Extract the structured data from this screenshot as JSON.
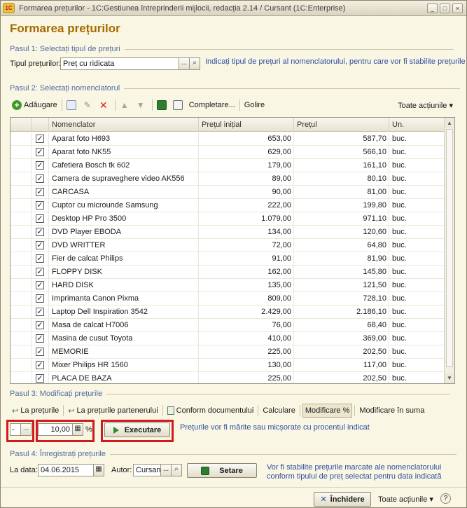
{
  "window": {
    "logo": "1C",
    "title": "Formarea prețurilor - 1C:Gestiunea întreprinderii mijlocii, redacția 2.14 / Cursant  (1C:Enterprise)",
    "minimize": "_",
    "maximize": "□",
    "close": "×"
  },
  "page_title": "Formarea prețurilor",
  "step1": {
    "header": "Pasul 1: Selectați tipul de prețuri",
    "price_type_label": "Tipul prețurilor:",
    "price_type_value": "Preț cu ridicata",
    "select_button": "...",
    "search_button": "⌕",
    "hint": "Indicați tipul de prețuri al nomenclatorului, pentru care vor fi stabilite prețurile"
  },
  "step2": {
    "header": "Pasul 2: Selectați nomenclatorul",
    "toolbar": {
      "add": "Adăugare",
      "fill": "Completare...",
      "clear": "Golire",
      "all_actions": "Toate acțiunile ▾"
    },
    "columns": {
      "item": "Nomenclator",
      "initial_price": "Prețul inițial",
      "price": "Prețul",
      "unit": "Un."
    },
    "rows": [
      {
        "check": "✓",
        "item": "Aparat foto H693",
        "initial": "653,00",
        "price": "587,70",
        "unit": "buc."
      },
      {
        "check": "✓",
        "item": "Aparat foto NK55",
        "initial": "629,00",
        "price": "566,10",
        "unit": "buc."
      },
      {
        "check": "✓",
        "item": "Cafetiera Bosch tk 602",
        "initial": "179,00",
        "price": "161,10",
        "unit": "buc."
      },
      {
        "check": "✓",
        "item": "Camera de supraveghere video AK556",
        "initial": "89,00",
        "price": "80,10",
        "unit": "buc."
      },
      {
        "check": "✓",
        "item": "CARCASA",
        "initial": "90,00",
        "price": "81,00",
        "unit": "buc."
      },
      {
        "check": "✓",
        "item": "Cuptor cu microunde Samsung",
        "initial": "222,00",
        "price": "199,80",
        "unit": "buc."
      },
      {
        "check": "✓",
        "item": "Desktop HP Pro 3500",
        "initial": "1.079,00",
        "price": "971,10",
        "unit": "buc."
      },
      {
        "check": "✓",
        "item": "DVD Player EBODA",
        "initial": "134,00",
        "price": "120,60",
        "unit": "buc."
      },
      {
        "check": "✓",
        "item": "DVD WRITTER",
        "initial": "72,00",
        "price": "64,80",
        "unit": "buc."
      },
      {
        "check": "✓",
        "item": "Fier de calcat Philips",
        "initial": "91,00",
        "price": "81,90",
        "unit": "buc."
      },
      {
        "check": "✓",
        "item": "FLOPPY DISK",
        "initial": "162,00",
        "price": "145,80",
        "unit": "buc."
      },
      {
        "check": "✓",
        "item": "HARD DISK",
        "initial": "135,00",
        "price": "121,50",
        "unit": "buc."
      },
      {
        "check": "✓",
        "item": "Imprimanta Canon Pixma",
        "initial": "809,00",
        "price": "728,10",
        "unit": "buc."
      },
      {
        "check": "✓",
        "item": "Laptop Dell Inspiration 3542",
        "initial": "2.429,00",
        "price": "2.186,10",
        "unit": "buc."
      },
      {
        "check": "✓",
        "item": "Masa de calcat H7006",
        "initial": "76,00",
        "price": "68,40",
        "unit": "buc."
      },
      {
        "check": "✓",
        "item": "Masina de cusut Toyota",
        "initial": "410,00",
        "price": "369,00",
        "unit": "buc."
      },
      {
        "check": "✓",
        "item": "MEMORIE",
        "initial": "225,00",
        "price": "202,50",
        "unit": "buc."
      },
      {
        "check": "✓",
        "item": "Mixer Philips HR 1560",
        "initial": "130,00",
        "price": "117,00",
        "unit": "buc."
      },
      {
        "check": "✓",
        "item": "PLACA DE BAZA",
        "initial": "225,00",
        "price": "202,50",
        "unit": "buc."
      }
    ]
  },
  "step3": {
    "header": "Pasul 3: Modificați prețurile",
    "tabs": [
      "La prețurile",
      "La prețurile partenerului",
      "Conform documentului",
      "Calculare",
      "Modificare %",
      "Modificare în suma"
    ],
    "sign_value": "-",
    "sign_button": "...",
    "percent_value": "10,00",
    "percent_unit": "%",
    "execute_button": "Executare",
    "hint": "Prețurile vor fi mărite sau micșorate cu procentul indicat"
  },
  "step4": {
    "header": "Pasul 4: Înregistrați prețurile",
    "date_label": "La data:",
    "date_value": "04.06.2015",
    "author_label": "Autor:",
    "author_value": "Cursant",
    "author_button": "...",
    "set_button": "Setare",
    "hint_line1": "Vor fi stabilite prețurile marcate ale nomenclatorului",
    "hint_line2": "conform tipului de preț selectat pentru data indicată"
  },
  "footer": {
    "close_button": "Închidere",
    "all_actions": "Toate acțiunile ▾",
    "help": "?"
  }
}
